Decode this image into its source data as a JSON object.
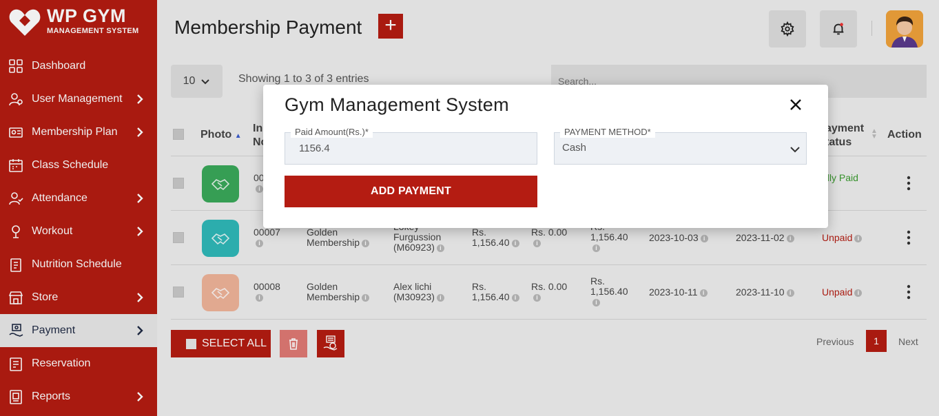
{
  "brand": {
    "title": "WP GYM",
    "subtitle": "MANAGEMENT SYSTEM"
  },
  "sidebar": {
    "items": [
      {
        "label": "Dashboard",
        "icon": "dashboard-grid-icon",
        "chevron": false
      },
      {
        "label": "User Management",
        "icon": "users-gear-icon",
        "chevron": true
      },
      {
        "label": "Membership Plan",
        "icon": "membership-card-icon",
        "chevron": true
      },
      {
        "label": "Class Schedule",
        "icon": "calendar-icon",
        "chevron": false
      },
      {
        "label": "Attendance",
        "icon": "user-check-icon",
        "chevron": true
      },
      {
        "label": "Workout",
        "icon": "workout-icon",
        "chevron": true
      },
      {
        "label": "Nutrition Schedule",
        "icon": "nutrition-icon",
        "chevron": false
      },
      {
        "label": "Store",
        "icon": "store-icon",
        "chevron": true
      },
      {
        "label": "Payment",
        "icon": "payment-hand-icon",
        "chevron": true,
        "active": true
      },
      {
        "label": "Reservation",
        "icon": "reservation-icon",
        "chevron": false
      },
      {
        "label": "Reports",
        "icon": "reports-icon",
        "chevron": true
      }
    ]
  },
  "header": {
    "title": "Membership Payment",
    "add_label": "+"
  },
  "controls": {
    "page_length": "10",
    "entries_info": "Showing 1 to 3 of 3 entries",
    "search_placeholder": "Search..."
  },
  "table": {
    "headers": {
      "photo": "Photo",
      "invoice_a": "In",
      "invoice_b": "No",
      "payment_status_a": "ayment",
      "payment_status_b": "tatus",
      "action": "Action"
    },
    "rows": [
      {
        "photo_color": "#3aa85a",
        "invoice": "00",
        "title_a": "",
        "title_b": "",
        "member_a": "",
        "member_b": "",
        "member_c": "",
        "amount_a": "",
        "amount_b": "",
        "paid": "",
        "due_a": "",
        "due_b": "",
        "start": "",
        "end": "",
        "status": "ully Paid",
        "status_type": "paid"
      },
      {
        "photo_color": "#2fb8b8",
        "invoice": "00007",
        "title_a": "Golden",
        "title_b": "Membership",
        "member_a": "Lokey",
        "member_b": "Furgussion",
        "member_c": "(M60923)",
        "amount_a": "Rs.",
        "amount_b": "1,156.40",
        "paid": "Rs. 0.00",
        "due_a": "Rs.",
        "due_b": "1,156.40",
        "start": "2023-10-03",
        "end": "2023-11-02",
        "status": "Unpaid",
        "status_type": "unpaid"
      },
      {
        "photo_color": "#f0b49a",
        "invoice": "00008",
        "title_a": "Golden",
        "title_b": "Membership",
        "member_a": "Alex lichi",
        "member_b": "(M30923)",
        "member_c": "",
        "amount_a": "Rs.",
        "amount_b": "1,156.40",
        "paid": "Rs. 0.00",
        "due_a": "Rs.",
        "due_b": "1,156.40",
        "start": "2023-10-11",
        "end": "2023-11-10",
        "status": "Unpaid",
        "status_type": "unpaid"
      }
    ]
  },
  "footer": {
    "select_all": "SELECT ALL",
    "previous": "Previous",
    "page": "1",
    "next": "Next"
  },
  "modal": {
    "title": "Gym Management System",
    "paid_amount_label": "Paid Amount(Rs.)*",
    "paid_amount_value": "1156.4",
    "payment_method_label": "PAYMENT METHOD*",
    "payment_method_value": "Cash",
    "submit_label": "ADD PAYMENT"
  },
  "colors": {
    "brand_red": "#b41c12",
    "paid_green": "#3a9b2e"
  }
}
